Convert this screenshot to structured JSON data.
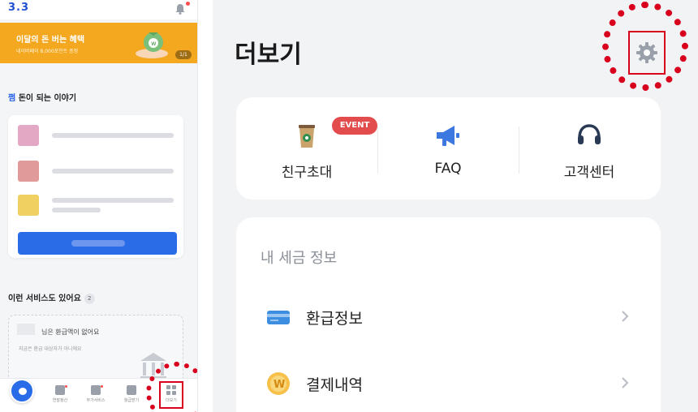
{
  "left_panel": {
    "logo": "3.3",
    "banner": {
      "title": "이달의 돈 버는 혜택",
      "subtitle": "네이버페이 8,000포인트 증정",
      "page_indicator": "1/1"
    },
    "story_section": {
      "brand": "쩜",
      "title": "돈이 되는 이야기"
    },
    "services_section": {
      "title": "이런 서비스도 있어요",
      "count": "2",
      "card_main": "님은 환급액이 없어요",
      "card_sub": "지금은 환급 대상자가 아니에요"
    },
    "tabbar": {
      "tabs": [
        {
          "label": "연말정산",
          "icon": "calendar-icon"
        },
        {
          "label": "부가서비스",
          "icon": "shield-icon"
        },
        {
          "label": "월급받기",
          "icon": "wallet-icon"
        },
        {
          "label": "더보기",
          "icon": "grid-icon"
        }
      ]
    }
  },
  "right_panel": {
    "title": "더보기",
    "settings_icon": "gear-icon",
    "quick_menu": [
      {
        "label": "친구초대",
        "icon": "coffee-cup-icon",
        "badge": "EVENT"
      },
      {
        "label": "FAQ",
        "icon": "megaphone-icon"
      },
      {
        "label": "고객센터",
        "icon": "headset-icon"
      }
    ],
    "tax_section": {
      "title": "내 세금 정보",
      "items": [
        {
          "label": "환급정보",
          "icon": "card-icon"
        },
        {
          "label": "결제내역",
          "icon": "won-coin-icon"
        }
      ]
    }
  },
  "colors": {
    "highlight_red": "#d8001c",
    "brand_blue": "#2a6be8",
    "banner_orange": "#f3a820",
    "event_badge": "#e24c4c"
  }
}
